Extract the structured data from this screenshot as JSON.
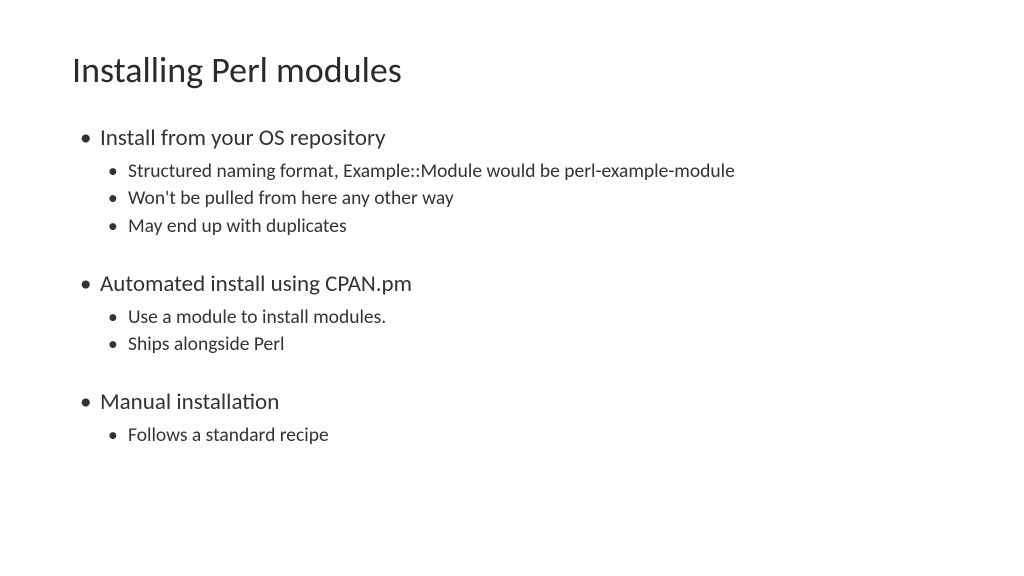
{
  "title": "Installing Perl modules",
  "groups": [
    {
      "heading": "Install from your OS repository",
      "items": [
        "Structured naming format, Example::Module would be perl-example-module",
        "Won't be pulled from here any other way",
        "May end up with duplicates"
      ]
    },
    {
      "heading": "Automated install using CPAN.pm",
      "items": [
        "Use a module to install modules.",
        "Ships alongside Perl"
      ]
    },
    {
      "heading": "Manual installation",
      "items": [
        "Follows a standard recipe"
      ]
    }
  ]
}
